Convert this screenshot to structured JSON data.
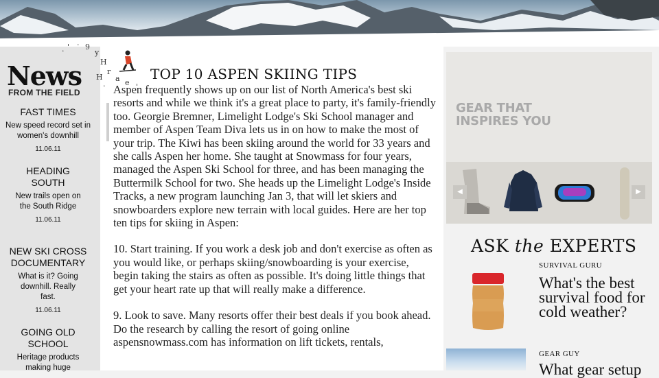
{
  "sidebar": {
    "title": "News",
    "subtitle": "FROM THE FIELD",
    "items": [
      {
        "heading": "FAST TIMES",
        "desc": "New speed record set in women's downhill",
        "date": "11.06.11"
      },
      {
        "heading": "HEADING SOUTH",
        "desc": "New trails open on the South Ridge",
        "date": "11.06.11"
      },
      {
        "heading": "NEW SKI CROSS DOCUMENTARY",
        "desc": "What is it? Going downhill. Really fast.",
        "date": "11.06.11"
      },
      {
        "heading": "GOING OLD SCHOOL",
        "desc": "Heritage products making huge",
        "date": ""
      }
    ]
  },
  "article": {
    "title": "TOP 10 ASPEN SKIING TIPS",
    "intro": "Aspen frequently shows up on our list of North America's best ski resorts and while we think it's a great place to party, it's family-friendly too. Georgie Bremner, Limelight Lodge's Ski School manager and member of Aspen Team Diva lets us in on how to make the most of your trip. The Kiwi has been skiing around the world for 33 years and she calls Aspen her home. She taught at Snowmass for four years, managed the Aspen Ski School for three, and has been managing the Buttermilk School for two. She heads up the Limelight Lodge's Inside Tracks, a new program launching Jan 3, that will let skiers and snowboarders explore new terrain with local guides. Here are her top ten tips for skiing in Aspen:",
    "tip10": "10. Start training. If you work a desk job and don't exercise as often as you would like, or perhaps skiing/snowboarding is your exercise, begin taking the stairs as often as possible. It's doing little things that get your heart rate up that will really make a difference.",
    "tip9": "9. Look to save. Many resorts offer their best deals if you book ahead. Do the research by calling the resort of going online aspensnowmass.com has information on lift tickets, rentals,"
  },
  "gear": {
    "line1": "GEAR THAT",
    "line2": "INSPIRES YOU",
    "prev_icon": "left-arrow-icon",
    "next_icon": "right-arrow-icon"
  },
  "experts": {
    "ask_pre": "ASK ",
    "ask_the": "the",
    "ask_post": " EXPERTS",
    "items": [
      {
        "tag": "SURVIVAL GURU",
        "question": "What's the best survival food for cold weather?"
      },
      {
        "tag": "GEAR GUY",
        "question": "What gear setup"
      }
    ]
  },
  "colors": {
    "sidebar_bg": "#e4e4e4",
    "gear_text": "#a9a9a9",
    "jar_lid": "#d9262b"
  }
}
